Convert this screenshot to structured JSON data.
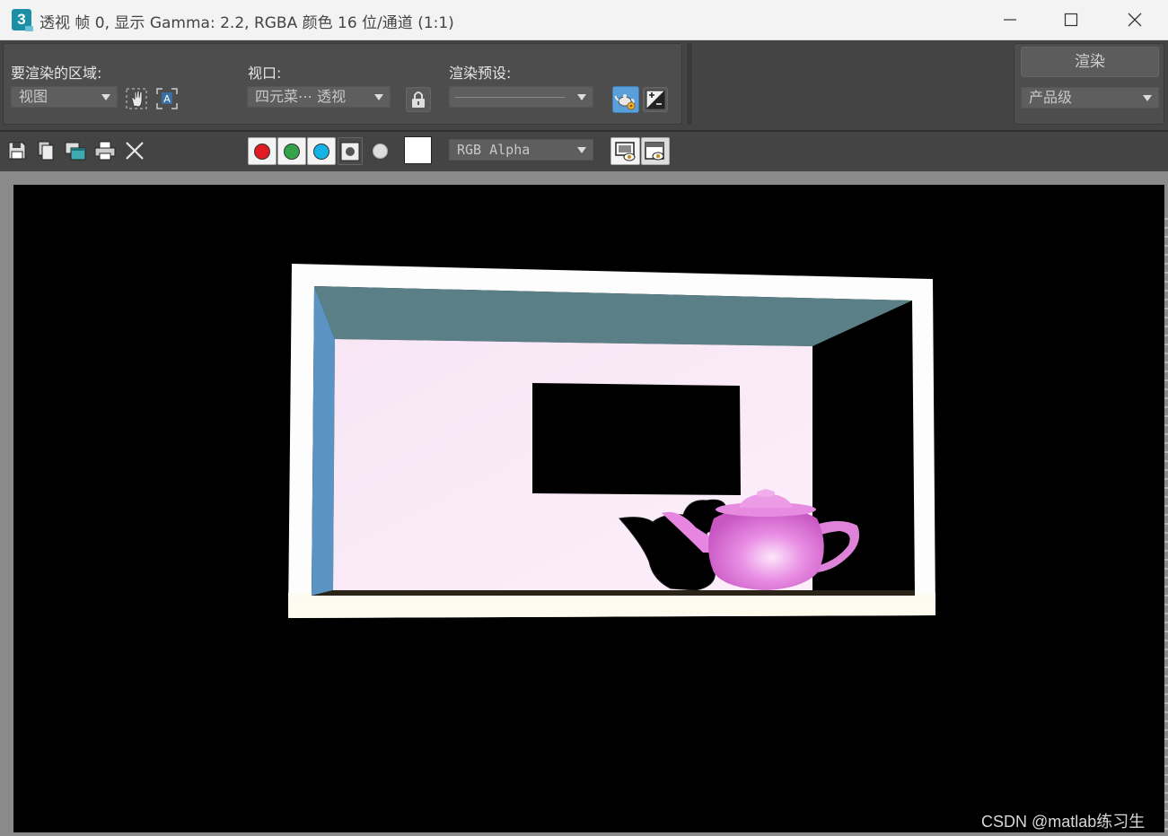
{
  "window": {
    "app_icon_text": "3",
    "title": "透视 帧 0, 显示 Gamma: 2.2, RGBA 颜色 16 位/通道 (1:1)"
  },
  "toolbar": {
    "area_label": "要渲染的区域:",
    "area_value": "视图",
    "viewport_label": "视口:",
    "viewport_value": "四元菜⋯ 透视",
    "preset_label": "渲染预设:",
    "preset_value": "",
    "render_button": "渲染",
    "quality_value": "产品级"
  },
  "channel_bar": {
    "channel_display": "RGB Alpha",
    "channels": [
      "red",
      "green",
      "blue",
      "alpha",
      "mono"
    ],
    "colors": {
      "red": "#e01b24",
      "green": "#33a34a",
      "blue": "#15b2e6"
    }
  },
  "watermark": "CSDN @matlab练习生"
}
